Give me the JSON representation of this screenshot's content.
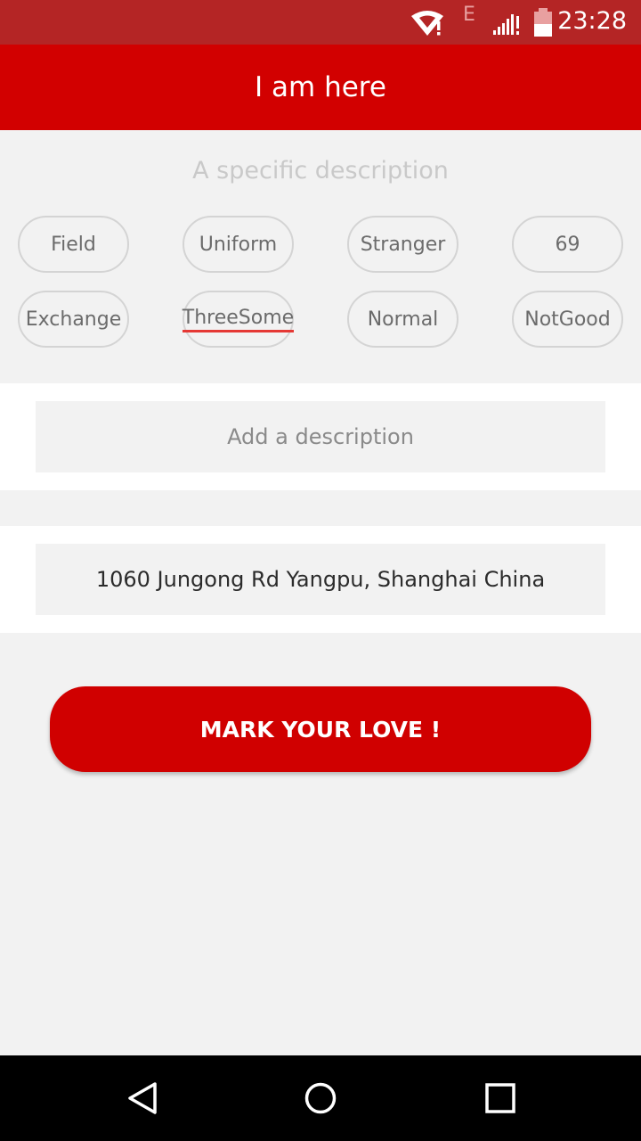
{
  "status_bar": {
    "time": "23:28",
    "network_letter": "E",
    "icons": [
      "wifi-alert-icon",
      "signal-alert-icon",
      "battery-icon"
    ]
  },
  "app_bar": {
    "title": "I am here"
  },
  "tags_section": {
    "hint": "A specific description",
    "tags": [
      "Field",
      "Uniform",
      "Stranger",
      "69",
      "Exchange",
      "ThreeSome",
      "Normal",
      "NotGood"
    ]
  },
  "description": {
    "placeholder": "Add a description",
    "value": ""
  },
  "address": {
    "text": "1060 Jungong Rd Yangpu, Shanghai China"
  },
  "action_button": {
    "label": "MARK YOUR LOVE !"
  },
  "nav_bar": {
    "icons": [
      "back-icon",
      "home-icon",
      "recents-icon"
    ]
  },
  "colors": {
    "status_bar": "#b42525",
    "accent": "#d20000",
    "background": "#f2f2f2",
    "underline": "#e53935"
  }
}
